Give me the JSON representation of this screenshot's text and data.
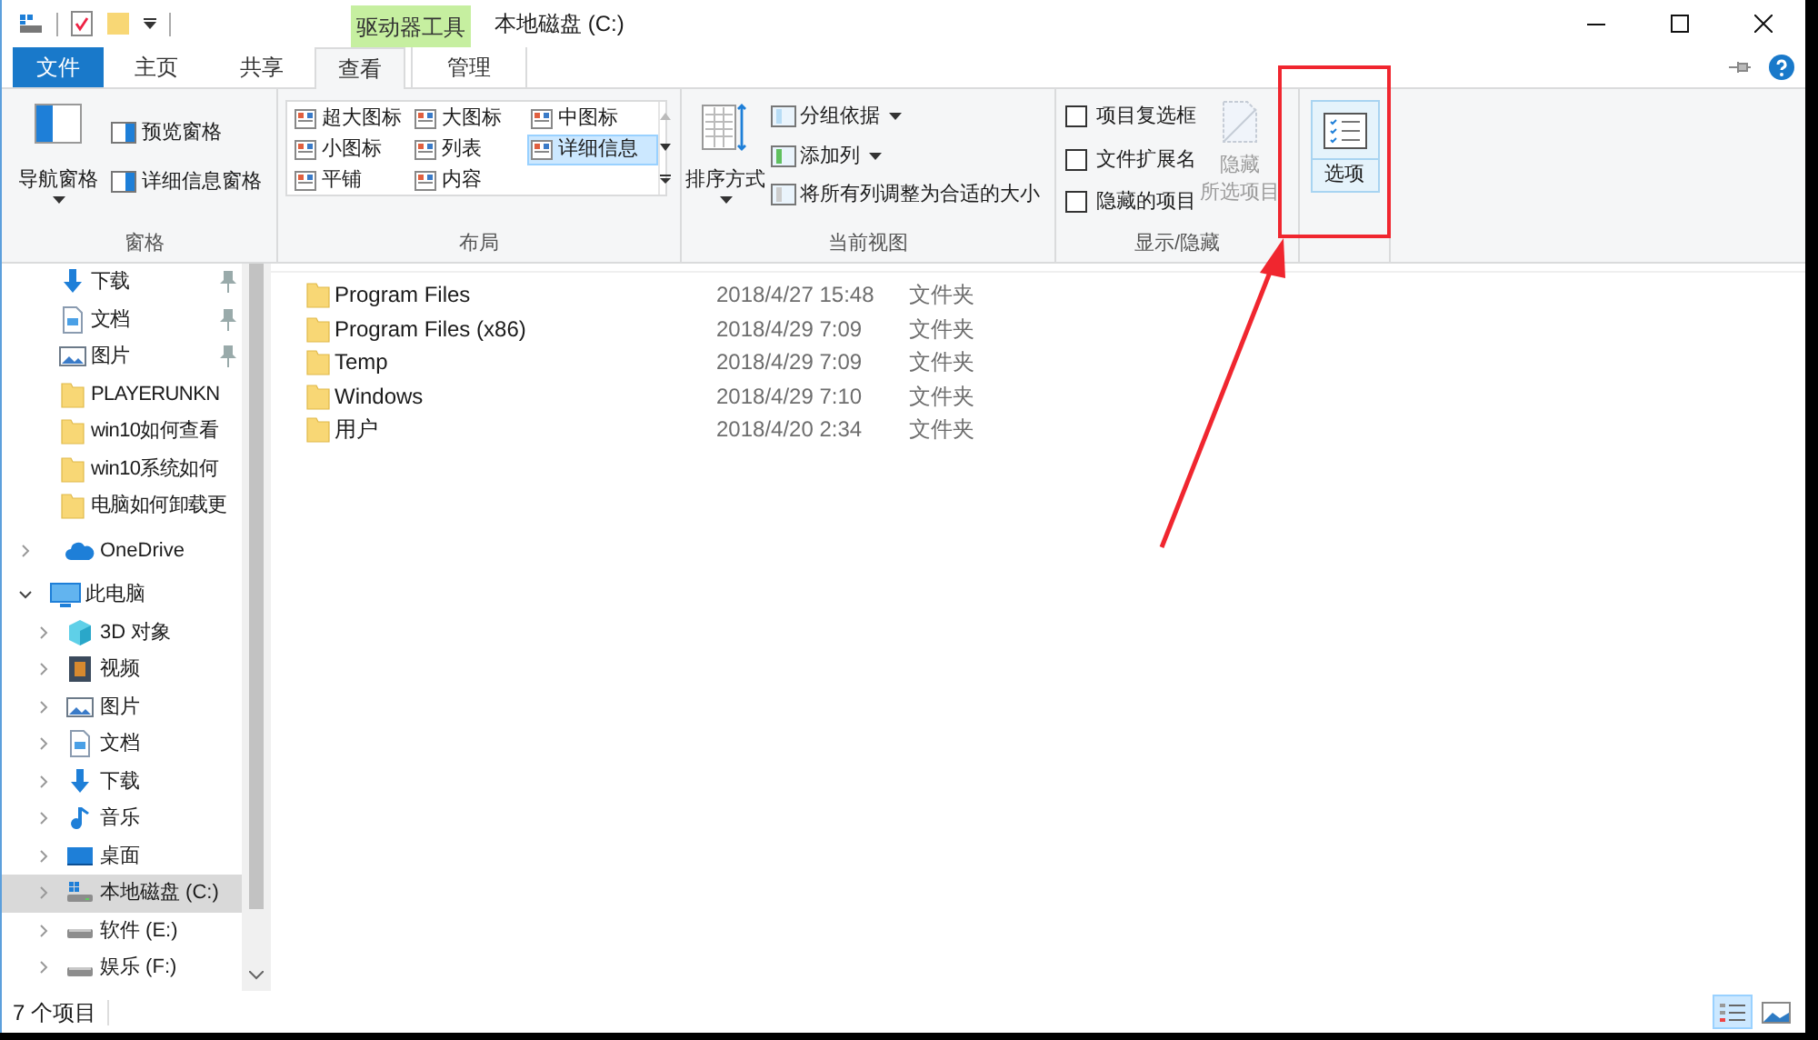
{
  "window": {
    "title": "本地磁盘 (C:)",
    "context_header": "驱动器工具"
  },
  "tabs": [
    {
      "label": "文件",
      "kind": "file",
      "selected": false
    },
    {
      "label": "主页",
      "kind": "plain",
      "selected": false
    },
    {
      "label": "共享",
      "kind": "plain",
      "selected": false
    },
    {
      "label": "查看",
      "kind": "plain",
      "selected": true
    },
    {
      "label": "管理",
      "kind": "contextual",
      "selected": false
    }
  ],
  "ribbon": {
    "panes": {
      "label": "窗格",
      "big": "导航窗格",
      "small": [
        "预览窗格",
        "详细信息窗格"
      ]
    },
    "layout": {
      "label": "布局",
      "options": [
        {
          "label": "超大图标",
          "selected": false
        },
        {
          "label": "大图标",
          "selected": false
        },
        {
          "label": "中图标",
          "selected": false
        },
        {
          "label": "小图标",
          "selected": false
        },
        {
          "label": "列表",
          "selected": false
        },
        {
          "label": "详细信息",
          "selected": true
        },
        {
          "label": "平铺",
          "selected": false
        },
        {
          "label": "内容",
          "selected": false
        }
      ]
    },
    "current_view": {
      "label": "当前视图",
      "big": "排序方式",
      "items": [
        {
          "label": "分组依据",
          "dropdown": true
        },
        {
          "label": "添加列",
          "dropdown": true
        },
        {
          "label": "将所有列调整为合适的大小",
          "dropdown": false
        }
      ]
    },
    "show_hide": {
      "label": "显示/隐藏",
      "checkboxes": [
        {
          "label": "项目复选框",
          "checked": false
        },
        {
          "label": "文件扩展名",
          "checked": false
        },
        {
          "label": "隐藏的项目",
          "checked": false
        }
      ],
      "hide_selected": {
        "lines": [
          "隐藏",
          "所选项目"
        ],
        "disabled": true
      }
    },
    "options": {
      "label": "选项",
      "selected": true
    }
  },
  "nav": {
    "quick_access": [
      {
        "label": "下载",
        "kind": "download",
        "pinned": true
      },
      {
        "label": "文档",
        "kind": "document",
        "pinned": true
      },
      {
        "label": "图片",
        "kind": "picture",
        "pinned": true
      },
      {
        "label": "PLAYERUNKN",
        "kind": "folder",
        "pinned": false
      },
      {
        "label": "win10如何查看",
        "kind": "folder",
        "pinned": false
      },
      {
        "label": "win10系统如何",
        "kind": "folder",
        "pinned": false
      },
      {
        "label": "电脑如何卸载更",
        "kind": "folder",
        "pinned": false
      }
    ],
    "onedrive": {
      "label": "OneDrive",
      "expanded": false
    },
    "this_pc": {
      "label": "此电脑",
      "expanded": true,
      "children": [
        {
          "label": "3D 对象",
          "kind": "cube",
          "selected": false
        },
        {
          "label": "视频",
          "kind": "video",
          "selected": false
        },
        {
          "label": "图片",
          "kind": "picture",
          "selected": false
        },
        {
          "label": "文档",
          "kind": "document",
          "selected": false
        },
        {
          "label": "下载",
          "kind": "download",
          "selected": false
        },
        {
          "label": "音乐",
          "kind": "music",
          "selected": false
        },
        {
          "label": "桌面",
          "kind": "desktop",
          "selected": false
        },
        {
          "label": "本地磁盘 (C:)",
          "kind": "system-drive",
          "selected": true
        },
        {
          "label": "软件 (E:)",
          "kind": "drive",
          "selected": false
        },
        {
          "label": "娱乐 (F:)",
          "kind": "drive",
          "selected": false
        }
      ]
    }
  },
  "files": [
    {
      "name": "Program Files",
      "modified": "2018/4/27 15:48",
      "type": "文件夹"
    },
    {
      "name": "Program Files (x86)",
      "modified": "2018/4/29 7:09",
      "type": "文件夹"
    },
    {
      "name": "Temp",
      "modified": "2018/4/29 7:09",
      "type": "文件夹"
    },
    {
      "name": "Windows",
      "modified": "2018/4/29 7:10",
      "type": "文件夹"
    },
    {
      "name": "用户",
      "modified": "2018/4/20 2:34",
      "type": "文件夹"
    }
  ],
  "status_bar": {
    "count": "7 个项目",
    "views": [
      {
        "kind": "details",
        "selected": true
      },
      {
        "kind": "thumbnails",
        "selected": false
      }
    ]
  }
}
